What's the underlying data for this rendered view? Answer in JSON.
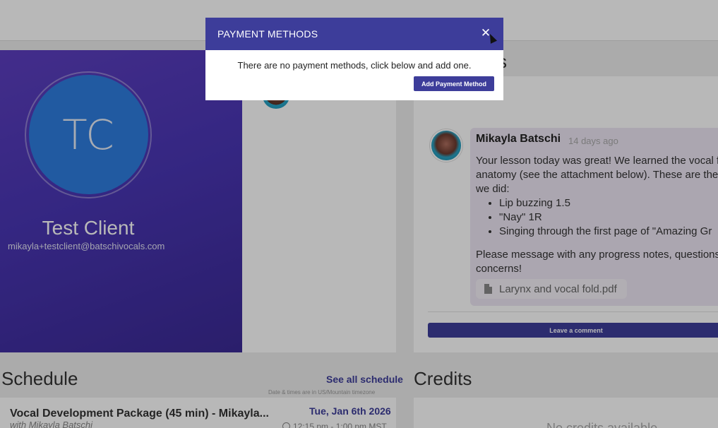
{
  "profile": {
    "initials": "TC",
    "name": "Test Client",
    "email": "mikayla+testclient@batschivocals.com",
    "avatar_color": "#2f7de0"
  },
  "comments": {
    "heading_fragment": "s",
    "author": "Mikayla Batschi",
    "time": "14 days ago",
    "body_intro_lines": [
      "Your lesson today was great! We learned the vocal f",
      "anatomy (see the attachment below). These are the",
      "we did:"
    ],
    "items": [
      "Lip buzzing 1.5",
      "\"Nay\" 1R",
      "Singing through the first page of \"Amazing Gr"
    ],
    "body_outro_lines": [
      "Please message with any progress notes, questions",
      "concerns!"
    ],
    "attachment": "Larynx and vocal fold.pdf",
    "attachment_icon": "pdf-file-icon",
    "leave_comment_label": "Leave a comment"
  },
  "schedule": {
    "title": "Schedule",
    "see_all_label": "See all schedule",
    "timezone_note": "Date & times are in US/Mountain timezone",
    "appointment": {
      "title": "Vocal Development Package (45 min) - Mikayla...",
      "with": "with Mikayla Batschi",
      "date": "Tue, Jan 6th 2026",
      "time": "12:15 pm - 1:00 pm MST",
      "time_icon": "clock-icon"
    }
  },
  "credits": {
    "title": "Credits",
    "empty_message": "No credits available"
  },
  "modal": {
    "title": "PAYMENT METHODS",
    "close_label": "✕",
    "close_icon": "close-icon",
    "message": "There are no payment methods, click below and add one.",
    "add_label": "Add Payment Method"
  },
  "colors": {
    "accent": "#3d3d9a",
    "profile_gradient_start": "#5d3fc0",
    "profile_gradient_end": "#3b2a95",
    "comment_bubble": "#ede6f4"
  }
}
